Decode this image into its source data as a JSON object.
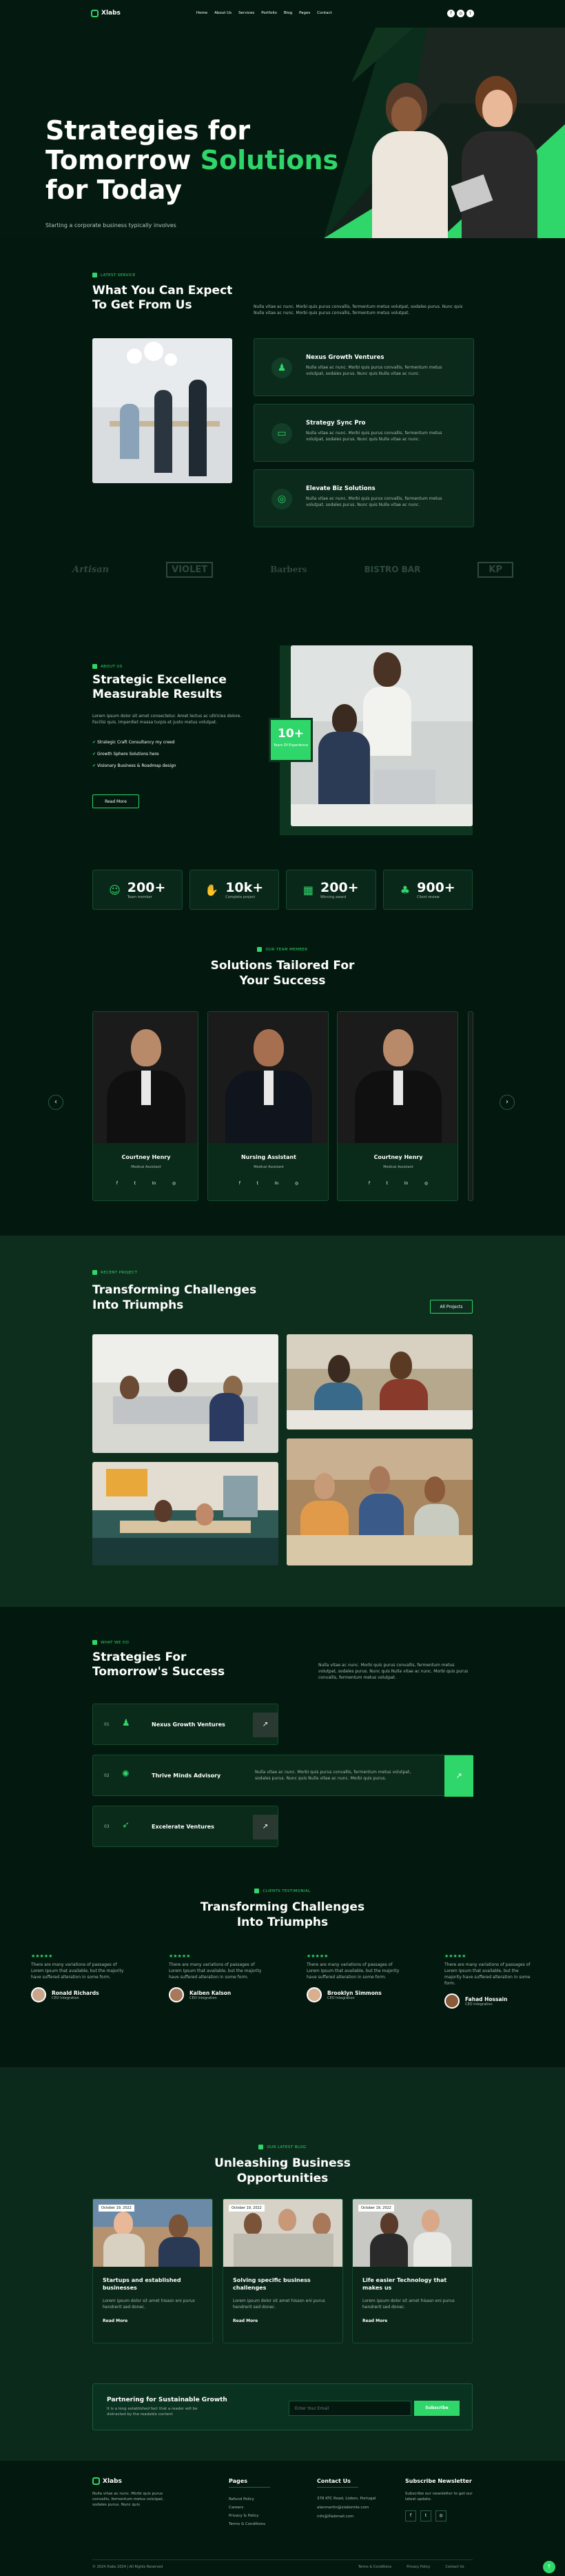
{
  "nav": {
    "logo": "Xlabs",
    "items": [
      "Home",
      "About Us",
      "Services",
      "Portfolio",
      "Blog",
      "Pages",
      "Contact"
    ]
  },
  "hero": {
    "title_1": "Strategies for",
    "title_2a": "Tomorrow ",
    "title_2b": "Solutions",
    "title_3": "for Today",
    "subtitle": "Starting a corporate business typically involves"
  },
  "expect": {
    "tag": "LATEST SERVICE",
    "title": "What You Can Expect To Get From Us",
    "desc": "Nulla vitae ac nunc. Morbi quis purus convallis, fermentum metus volutpat, sodales purus. Nunc quis Nulla vitae ac nunc. Morbi quis purus convallis, fermentum metus volutpat.",
    "items": [
      {
        "title": "Nexus Growth Ventures",
        "desc": "Nulla vitae ac nunc. Morbi quis purus convallis, fermentum metus volutpat, sodales purus. Nunc quis Nulla vitae ac nunc."
      },
      {
        "title": "Strategy Sync Pro",
        "desc": "Nulla vitae ac nunc. Morbi quis purus convallis, fermentum metus volutpat, sodales purus. Nunc quis Nulla vitae ac nunc."
      },
      {
        "title": "Elevate Biz Solutions",
        "desc": "Nulla vitae ac nunc. Morbi quis purus convallis, fermentum metus volutpat, sodales purus. Nunc quis Nulla vitae ac nunc."
      }
    ]
  },
  "logos": [
    "Artisan",
    "VIOLET",
    "Barbers",
    "BISTRO BAR",
    "KP"
  ],
  "excellence": {
    "tag": "ABOUT US",
    "title": "Strategic Excellence Measurable Results",
    "desc": "Lorem ipsum dolor sit amet consectetur. Amet lectus ac ultricies dolore. Facilisi quis. Imperdiet massa turpis et justo metus volutpat.",
    "list": [
      "Strategic Craft Consultancy my creed",
      "Growth Sphere Solutions here",
      "Visionary Business & Roadmap design"
    ],
    "button": "Read More",
    "badge_num": "10+",
    "badge_text": "Years Of Experience"
  },
  "stats": [
    {
      "num": "200+",
      "label": "Team member"
    },
    {
      "num": "10k+",
      "label": "Complete project"
    },
    {
      "num": "200+",
      "label": "Winning award"
    },
    {
      "num": "900+",
      "label": "Client review"
    }
  ],
  "team": {
    "tag": "OUR TEAM MEMBER",
    "title": "Solutions Tailored For Your Success",
    "members": [
      {
        "name": "Courtney Henry",
        "role": "Medical Assistant"
      },
      {
        "name": "Nursing Assistant",
        "role": "Medical Assistant"
      },
      {
        "name": "Courtney Henry",
        "role": "Medical Assistant"
      }
    ],
    "prev": "‹",
    "next": "›"
  },
  "projects": {
    "tag": "RECENT PROJECT",
    "title": "Transforming Challenges Into Triumphs",
    "button": "All Projects"
  },
  "strategies": {
    "tag": "WHAT WE DO",
    "title": "Strategies For Tomorrow's Success",
    "desc": "Nulla vitae ac nunc. Morbi quis purus convallis, fermentum metus volutpat, sodales purus. Nunc quis Nulla vitae ac nunc. Morbi quis purus convallis, fermentum metus volutpat.",
    "rows": [
      {
        "num": "01",
        "title": "Nexus Growth Ventures",
        "desc": ""
      },
      {
        "num": "02",
        "title": "Thrive Minds Advisory",
        "desc": "Nulla vitae ac nunc. Morbi quis purus convallis, fermentum metus volutpat, sodales purus. Nunc quis Nulla vitae ac nunc. Morbi quis purus."
      },
      {
        "num": "03",
        "title": "Excelerate Ventures",
        "desc": ""
      }
    ]
  },
  "testimonials": {
    "tag": "CLIENTS TESTIMONIAL",
    "title": "Transforming Challenges Into Triumphs",
    "items": [
      {
        "text": "There are many variations of passages of Lorem Ipsum that available, but the majority have suffered alteration in some form.",
        "name": "Ronald Richards",
        "role": "CEO Integration"
      },
      {
        "text": "There are many variations of passages of Lorem Ipsum that available, but the majority have suffered alteration in some form.",
        "name": "Kalben Kalson",
        "role": "CEO Integration"
      },
      {
        "text": "There are many variations of passages of Lorem Ipsum that available, but the majority have suffered alteration in some form.",
        "name": "Brooklyn Simmons",
        "role": "CEO Integration"
      },
      {
        "text": "There are many variations of passages of Lorem Ipsum that available, but the majority have suffered alteration in some form.",
        "name": "Fahad Hossain",
        "role": "CEO Integration"
      }
    ]
  },
  "blog": {
    "tag": "OUR LATEST BLOG",
    "title": "Unleashing Business Opportunities",
    "posts": [
      {
        "date": "October 19, 2022",
        "title": "Startups and established businesses",
        "desc": "Lorem ipsum dolor sit amet hisasn eni purus hendrerit sed donec.",
        "more": "Read More"
      },
      {
        "date": "October 19, 2022",
        "title": "Solving specific business challenges",
        "desc": "Lorem ipsum dolor sit amet hisasn eni purus hendrerit sed donec.",
        "more": "Read More"
      },
      {
        "date": "October 19, 2022",
        "title": "Life easier Technology that makes us",
        "desc": "Lorem ipsum dolor sit amet hisasn eni purus hendrerit sed donec.",
        "more": "Read More"
      }
    ]
  },
  "newsletter": {
    "title": "Partnering for Sustainable Growth",
    "desc": "It is a long established fact that a reader will be distracted by the readable content",
    "placeholder": "Enter Your Email",
    "button": "Subscribe"
  },
  "footer": {
    "logo": "Xlabs",
    "about": "Nulla vitae ac nunc. Morbi quis purus convallis, fermentum metus volutpat, sodales purus. Nunc quis",
    "pages_title": "Pages",
    "pages": [
      "Refund Policy",
      "Careers",
      "Privacy & Policy",
      "Terms & Conditions"
    ],
    "contact_title": "Contact Us",
    "contact": [
      "378 KTC Road, Lisbon, Portugal",
      "alanmartin@xlabsmile.com",
      "info@Xlabmail.com"
    ],
    "subscribe_title": "Subscribe Newsletter",
    "subscribe_desc": "Subscribe our newsletter to get our latest update.",
    "copyright": "© 2024 Xlabs 2024 | All Rights Reserved",
    "bottom_links": [
      "Terms & Conditions",
      "Privacy Policy",
      "Contact Us"
    ]
  },
  "colors": {
    "accent": "#2fd66a",
    "bg": "#03190f"
  }
}
